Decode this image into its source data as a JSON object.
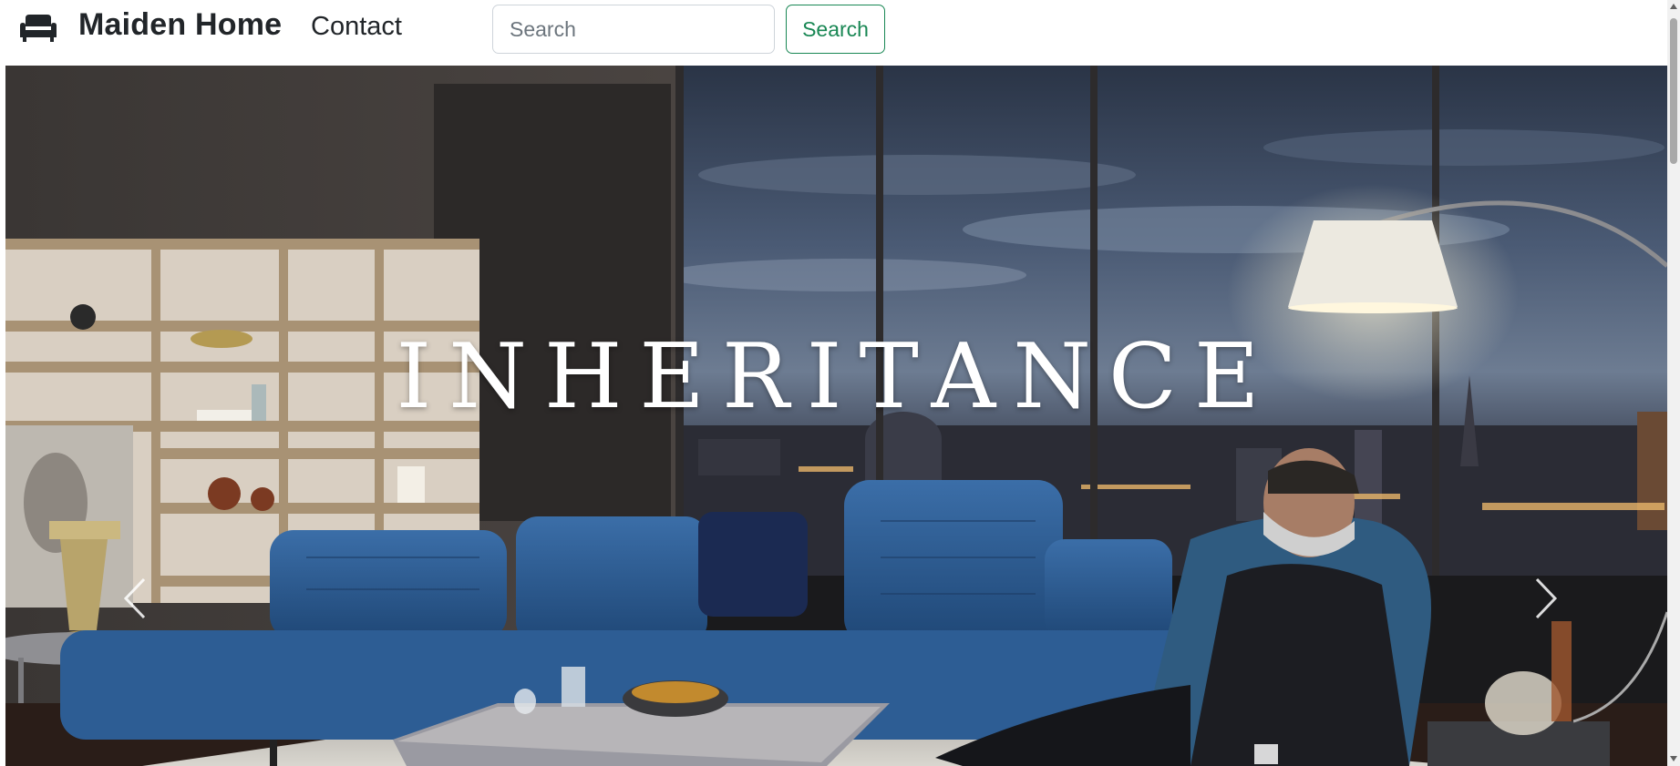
{
  "navbar": {
    "brand_icon": "sofa-icon",
    "brand": "Maiden Home",
    "links": [
      {
        "label": "Contact"
      }
    ],
    "search": {
      "placeholder": "Search",
      "value": "",
      "button_label": "Search"
    },
    "colors": {
      "button_accent": "#198754",
      "text": "#212529"
    }
  },
  "carousel": {
    "slide": {
      "title": "INHERITANCE",
      "image_subject": "blue tufted leather sectional sofa in a penthouse living room at dusk with a man in a suit seated in a blue armchair"
    },
    "controls": {
      "prev_icon": "chevron-left-icon",
      "next_icon": "chevron-right-icon"
    }
  },
  "scrollbar": {
    "up_icon": "scroll-up-arrow-icon",
    "down_icon": "scroll-down-arrow-icon"
  }
}
